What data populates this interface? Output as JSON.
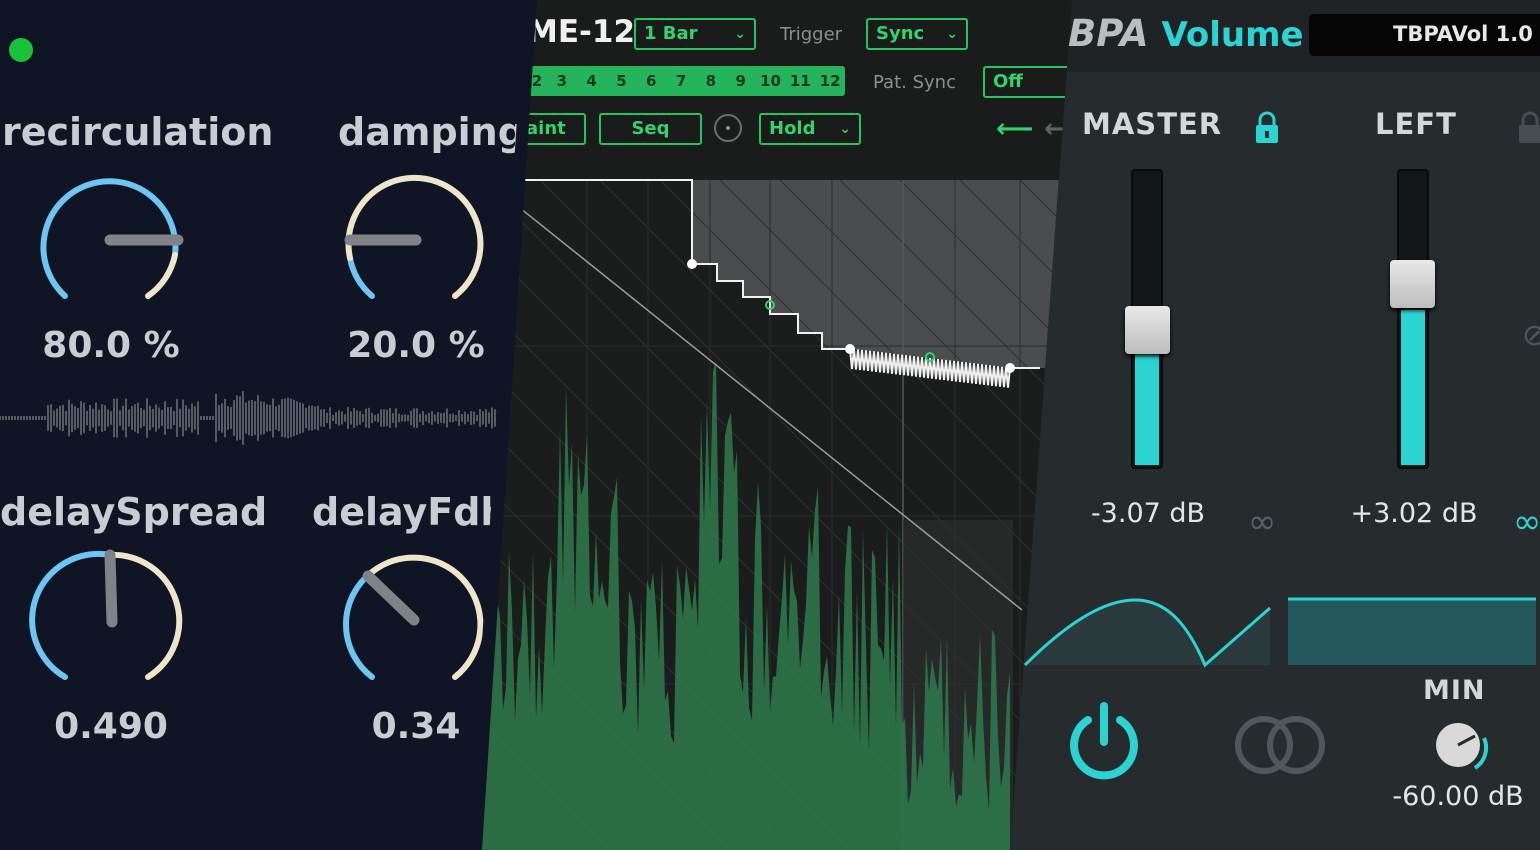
{
  "delay_panel": {
    "knobs": [
      {
        "label": "recirculation",
        "value": "80.0 %"
      },
      {
        "label": "damping",
        "value": "20.0 %"
      },
      {
        "label": "delaySpread",
        "value": "0.490"
      },
      {
        "label": "delayFdbc",
        "value": "0.34"
      }
    ],
    "status_color": "#19c23a"
  },
  "env_panel": {
    "title": "ME-12",
    "length_select": "1 Bar",
    "trigger_label": "Trigger",
    "trigger_select": "Sync",
    "steps": [
      "2",
      "3",
      "4",
      "5",
      "6",
      "7",
      "8",
      "9",
      "10",
      "11",
      "12"
    ],
    "pat_sync_label": "Pat. Sync",
    "pat_sync_select": "Off",
    "paint_button": "aint",
    "seq_button": "Seq",
    "hold_select": "Hold",
    "accent": "#23c560"
  },
  "volume_panel": {
    "brand": "BPA",
    "product": "Volume",
    "preset_name": "TBPAVol 1.0",
    "master_label": "MASTER",
    "left_label": "LEFT",
    "master_value": "-3.07 dB",
    "left_value": "+3.02 dB",
    "min_label": "MIN",
    "min_value": "-60.00 dB",
    "accent": "#2bd3d3"
  }
}
